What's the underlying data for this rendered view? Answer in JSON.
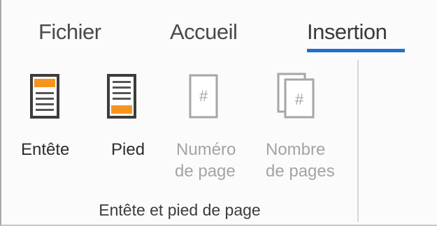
{
  "ribbon": {
    "tabs": [
      {
        "label": "Fichier"
      },
      {
        "label": "Accueil"
      },
      {
        "label": "Insertion",
        "active": true
      }
    ],
    "active_tab_color": "#1f6fd1",
    "group": {
      "label": "Entête et pied de page",
      "commands": [
        {
          "line1": "Entête",
          "line2": "",
          "icon": "header-page-icon",
          "enabled": true
        },
        {
          "line1": "Pied",
          "line2": "",
          "icon": "footer-page-icon",
          "enabled": true
        },
        {
          "line1": "Numéro",
          "line2": "de page",
          "icon": "page-number-icon",
          "enabled": false
        },
        {
          "line1": "Nombre",
          "line2": "de pages",
          "icon": "page-count-icon",
          "enabled": false
        }
      ]
    },
    "accent_color": "#f7941d"
  }
}
